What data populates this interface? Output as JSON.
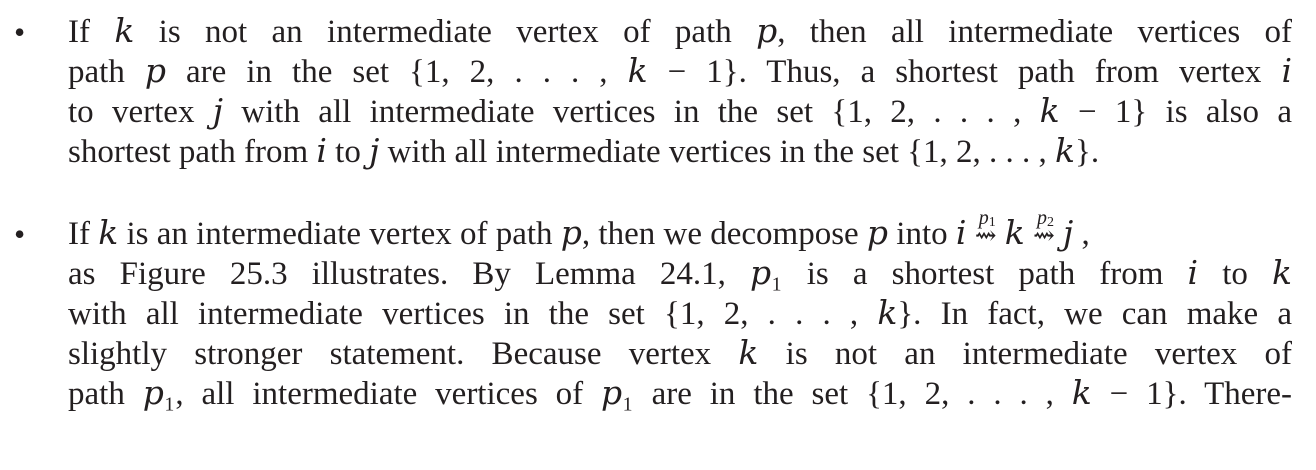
{
  "bullets": [
    {
      "marker": "•",
      "lines": [
        "If 𝑘 is not an intermediate vertex of path 𝑝, then all intermediate vertices of",
        "path 𝑝 are in the set {1, 2, . . . , 𝑘 − 1}.  Thus, a shortest path from vertex 𝑖",
        "to vertex 𝑗 with all intermediate vertices in the set {1, 2, . . . , 𝑘 − 1} is also a",
        "shortest path from 𝑖 to 𝑗 with all intermediate vertices in the set {1, 2, . . . , 𝑘}."
      ]
    },
    {
      "marker": "•",
      "first_line": {
        "before": "If 𝑘 is an intermediate vertex of path 𝑝, then we decompose 𝑝 into 𝑖 ",
        "arrow": "⇝",
        "label1": "p",
        "label1_sub": "1",
        "middle": " 𝑘 ",
        "label2": "p",
        "label2_sub": "2",
        "after": " 𝑗 ,"
      },
      "lines": [
        "as Figure 25.3 illustrates.  By Lemma 24.1, 𝑝₁ is a shortest path from 𝑖 to 𝑘",
        "with all intermediate vertices in the set {1, 2, . . . , 𝑘}.  In fact, we can make a",
        "slightly stronger statement.  Because vertex 𝑘 is not an intermediate vertex of",
        "path 𝑝₁, all intermediate vertices of 𝑝₁ are in the set {1, 2, . . . , 𝑘 − 1}.  There-"
      ]
    }
  ]
}
